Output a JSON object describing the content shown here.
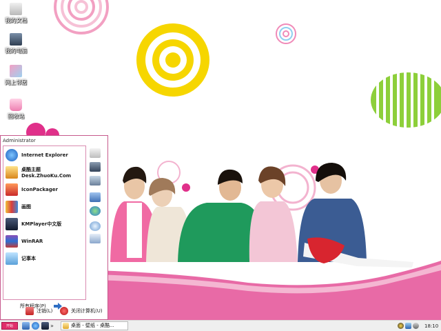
{
  "desktop": {
    "icons": [
      {
        "label": "我的文档",
        "icon": "folder-documents-icon"
      },
      {
        "label": "我的电脑",
        "icon": "computer-icon"
      },
      {
        "label": "网上邻居",
        "icon": "network-icon"
      },
      {
        "label": "回收站",
        "icon": "recycle-bin-icon"
      }
    ]
  },
  "start_menu": {
    "user": "Administrator",
    "items": [
      {
        "label": "Internet Explorer",
        "sub": "",
        "icon": "internet-explorer-icon"
      },
      {
        "label": "桌酷主题",
        "sub": "Desk.ZhuoKu.Com",
        "icon": "zhuoku-theme-icon"
      },
      {
        "label": "IconPackager",
        "sub": "",
        "icon": "iconpackager-icon"
      },
      {
        "label": "画图",
        "sub": "",
        "icon": "paint-icon"
      },
      {
        "label": "KMPlayer中文版",
        "sub": "",
        "icon": "kmplayer-icon"
      },
      {
        "label": "WinRAR",
        "sub": "",
        "icon": "winrar-icon"
      },
      {
        "label": "记事本",
        "sub": "",
        "icon": "notepad-icon"
      }
    ],
    "all_programs": "所有程序(P)",
    "logoff": "注销(L)",
    "shutdown": "关闭计算机(U)"
  },
  "taskbar": {
    "start_label": "开始",
    "more": "»",
    "tasks": [
      "桌面 - 壁纸 - 桌酷..."
    ],
    "clock": "18:10"
  },
  "colors": {
    "accent": "#e02e6a",
    "menu_border": "#c6588c",
    "pink_floor": "#e2559a",
    "yellow_circle": "#f6d600",
    "green_stripes": "#8dcf3a"
  }
}
